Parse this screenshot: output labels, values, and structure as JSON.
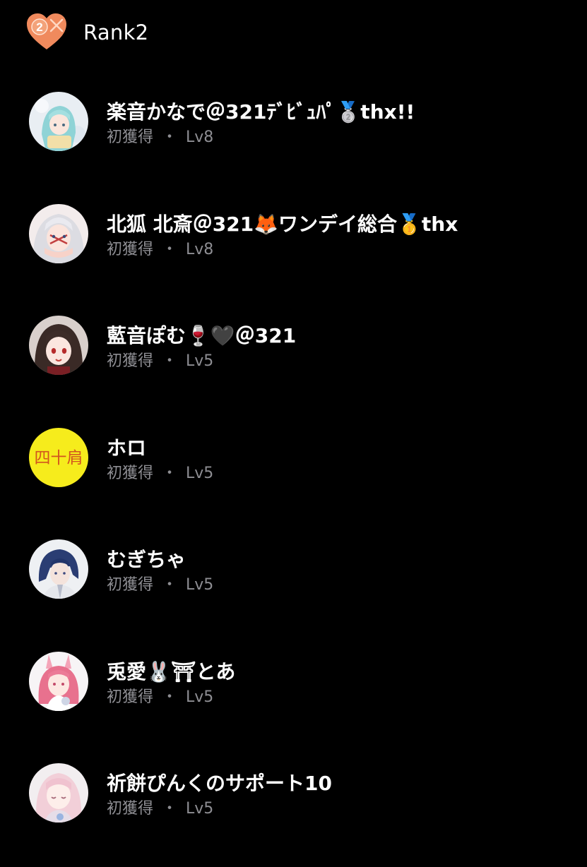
{
  "header": {
    "badge_number": "2",
    "badge_icon": "heart-rank-icon",
    "title": "Rank2"
  },
  "colors": {
    "background": "#000000",
    "primary_text": "#ffffff",
    "secondary_text": "#8e8e93",
    "badge_orange": "#f08a5d"
  },
  "users": [
    {
      "name": "楽音かなで＠321ﾃﾞﾋﾞｭﾊﾟ🥈thx!!",
      "status": "初獲得",
      "level": "Lv8",
      "avatar": "anime-girl-light-blue-hair"
    },
    {
      "name": "北狐 北斎＠321🦊ワンデイ総合🥇thx",
      "status": "初獲得",
      "level": "Lv8",
      "avatar": "anime-character-white-hair"
    },
    {
      "name": "藍音ぽむ🍷🖤＠321",
      "status": "初獲得",
      "level": "Lv5",
      "avatar": "anime-girl-dark-hair"
    },
    {
      "name": "ホロ",
      "status": "初獲得",
      "level": "Lv5",
      "avatar": "yellow-circle-text",
      "avatar_text": "四十肩"
    },
    {
      "name": "むぎちゃ",
      "status": "初獲得",
      "level": "Lv5",
      "avatar": "anime-boy-navy-hair"
    },
    {
      "name": "兎愛🐰⛩とあ",
      "status": "初獲得",
      "level": "Lv5",
      "avatar": "anime-girl-pink-bunny"
    },
    {
      "name": "祈餅ぴんくのサポート10",
      "status": "初獲得",
      "level": "Lv5",
      "avatar": "anime-girl-pink-pastel"
    }
  ]
}
